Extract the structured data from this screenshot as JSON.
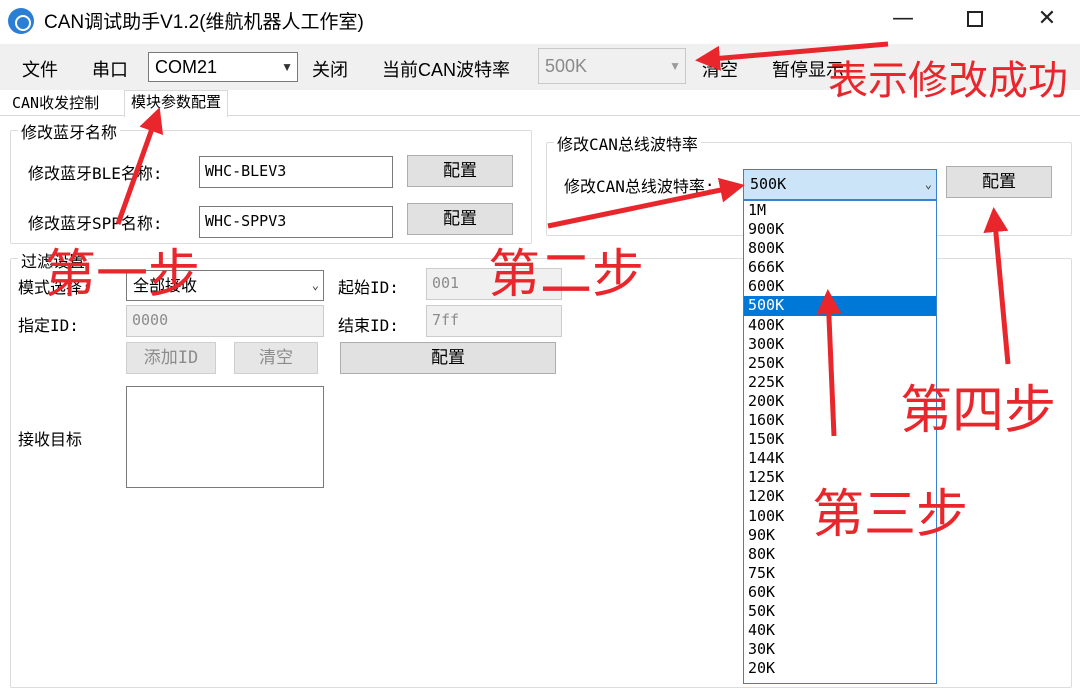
{
  "window": {
    "title": "CAN调试助手V1.2(维航机器人工作室)",
    "minimize_glyph": "—",
    "close_glyph": "✕"
  },
  "toolbar": {
    "menu_file": "文件",
    "menu_serial": "串口",
    "port_value": "COM21",
    "close_label": "关闭",
    "baud_label": "当前CAN波特率",
    "baud_value": "500K",
    "clear_label": "清空",
    "pause_label": "暂停显示"
  },
  "tabs": [
    {
      "label": "CAN收发控制"
    },
    {
      "label": "模块参数配置",
      "active": true
    }
  ],
  "bluetooth_group": {
    "title": "修改蓝牙名称",
    "ble_label": "修改蓝牙BLE名称:",
    "ble_value": "WHC-BLEV3",
    "spp_label": "修改蓝牙SPP名称:",
    "spp_value": "WHC-SPPV3",
    "config_label": "配置"
  },
  "can_baud_group": {
    "title": "修改CAN总线波特率",
    "label": "修改CAN总线波特率:",
    "selected": "500K",
    "config_label": "配置",
    "options": [
      "1M",
      "900K",
      "800K",
      "666K",
      "600K",
      "500K",
      "400K",
      "300K",
      "250K",
      "225K",
      "200K",
      "160K",
      "150K",
      "144K",
      "125K",
      "120K",
      "100K",
      "90K",
      "80K",
      "75K",
      "60K",
      "50K",
      "40K",
      "30K",
      "20K"
    ]
  },
  "filter_group": {
    "title": "过滤设置",
    "mode_label": "模式选择:",
    "mode_value": "全部接收",
    "start_id_label": "起始ID:",
    "start_id_value": "001",
    "assign_id_label": "指定ID:",
    "assign_id_value": "0000",
    "end_id_label": "结束ID:",
    "end_id_value": "7ff",
    "add_id_label": "添加ID",
    "clear_label": "清空",
    "config_label": "配置",
    "receive_target_label": "接收目标"
  },
  "annotations": {
    "success": "表示修改成功",
    "step1": "第一步",
    "step2": "第二步",
    "step3": "第三步",
    "step4": "第四步"
  },
  "colors": {
    "annotation_red": "#e8262c",
    "selection_blue": "#0078d7",
    "toolbar_bg": "#f0f0f0"
  }
}
